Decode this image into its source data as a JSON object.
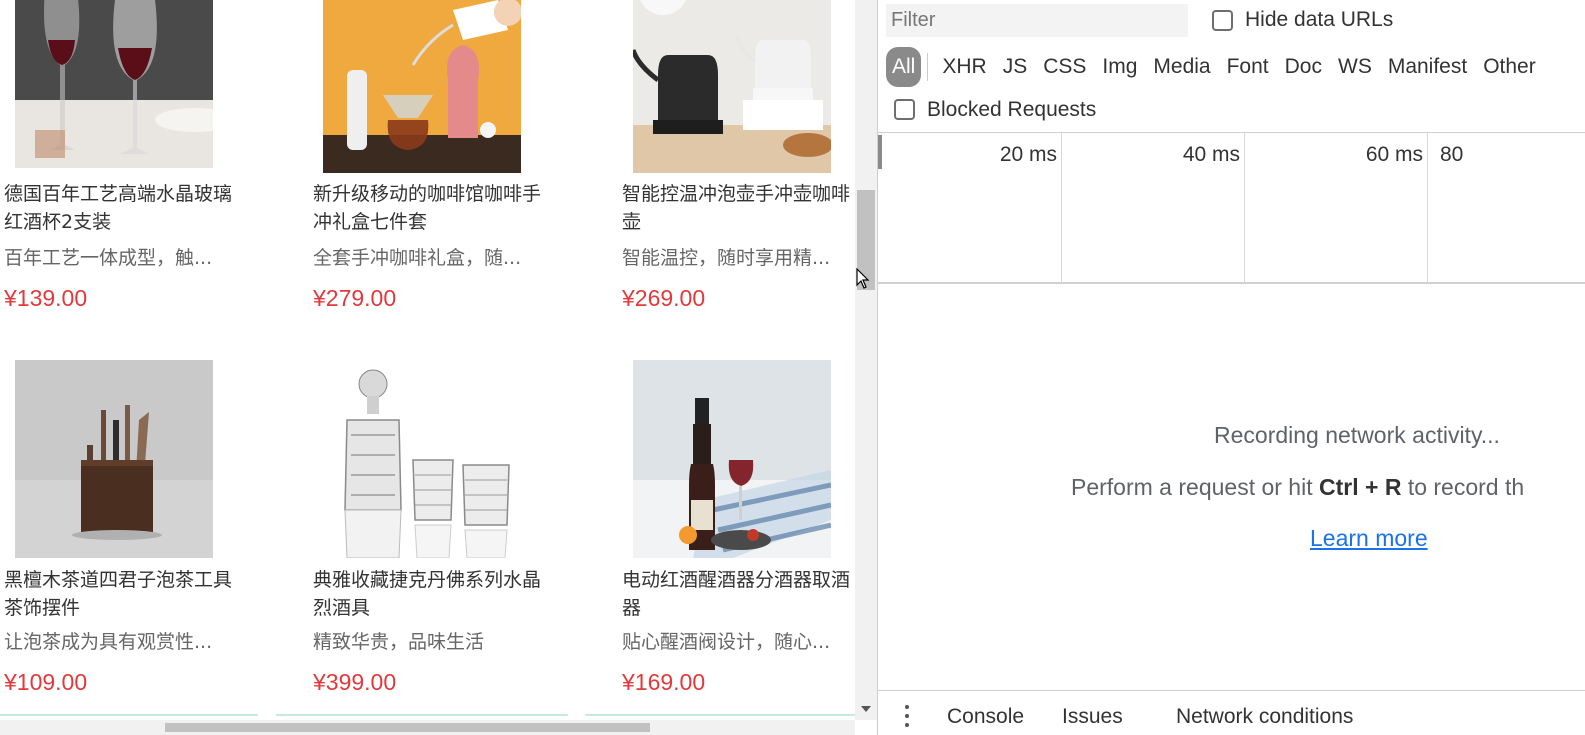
{
  "products": [
    {
      "name": "德国百年工艺高端水晶玻璃红酒杯2支装",
      "desc": "百年工艺一体成型，触...",
      "price": "¥139.00"
    },
    {
      "name": "新升级移动的咖啡馆咖啡手冲礼盒七件套",
      "desc": "全套手冲咖啡礼盒，随...",
      "price": "¥279.00"
    },
    {
      "name": "智能控温冲泡壶手冲壶咖啡壶",
      "desc": "智能温控，随时享用精...",
      "price": "¥269.00"
    },
    {
      "name": "黑檀木茶道四君子泡茶工具茶饰摆件",
      "desc": "让泡茶成为具有观赏性...",
      "price": "¥109.00"
    },
    {
      "name": "典雅收藏捷克丹佛系列水晶烈酒具",
      "desc": "精致华贵，品味生活",
      "price": "¥399.00"
    },
    {
      "name": "电动红酒醒酒器分酒器取酒器",
      "desc": "贴心醒酒阀设计，随心...",
      "price": "¥169.00"
    }
  ],
  "devtools": {
    "filter_placeholder": "Filter",
    "hide_data_urls": "Hide data URLs",
    "blocked_requests": "Blocked Requests",
    "types": [
      "All",
      "XHR",
      "JS",
      "CSS",
      "Img",
      "Media",
      "Font",
      "Doc",
      "WS",
      "Manifest",
      "Other"
    ],
    "ticks": [
      "20 ms",
      "40 ms",
      "60 ms",
      "80"
    ],
    "recording": "Recording network activity...",
    "perform_prefix": "Perform a request or hit ",
    "perform_keys": "Ctrl + R",
    "perform_suffix": " to record th",
    "learn_more": "Learn more",
    "drawer_tabs": [
      "Console",
      "Issues",
      "Network conditions"
    ]
  }
}
